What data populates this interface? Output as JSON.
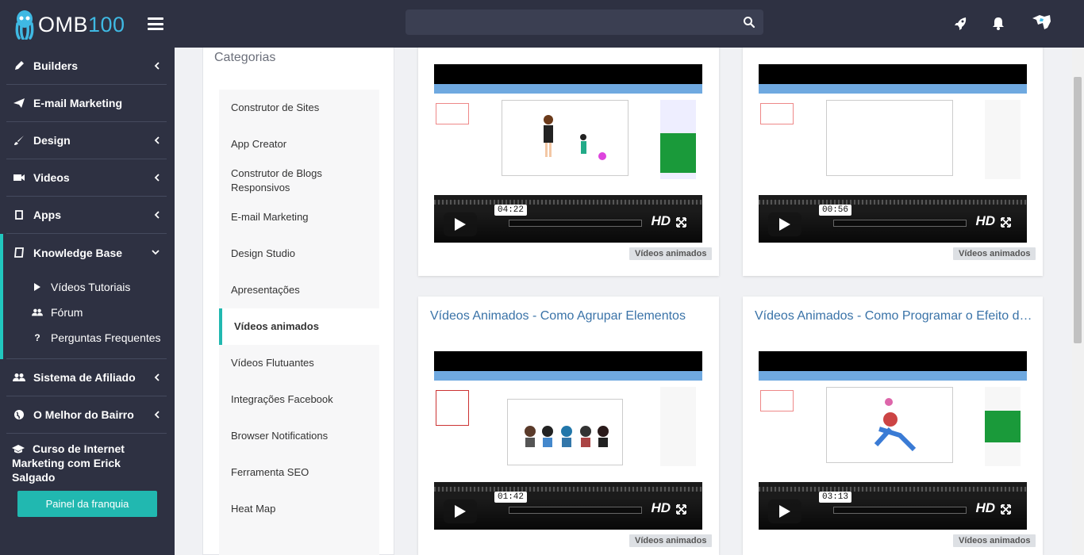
{
  "brand": {
    "logo_prefix": "OMB",
    "logo_suffix": "100",
    "accent": "#21b8b0",
    "link_color": "#3a73a8"
  },
  "topbar": {
    "search_placeholder": ""
  },
  "sidebar": {
    "items": [
      {
        "label": "Builders",
        "icon": "pencil-icon"
      },
      {
        "label": "E-mail Marketing",
        "icon": "paper-plane-icon"
      },
      {
        "label": "Design",
        "icon": "brush-icon"
      },
      {
        "label": "Videos",
        "icon": "video-camera-icon"
      },
      {
        "label": "Apps",
        "icon": "tablet-icon"
      }
    ],
    "knowledge_base": {
      "label": "Knowledge Base",
      "children": [
        {
          "label": "Vídeos Tutoriais",
          "icon": "play-icon"
        },
        {
          "label": "Fórum",
          "icon": "users-icon"
        },
        {
          "label": "Perguntas Frequentes",
          "icon": "question-icon"
        }
      ]
    },
    "items_after": [
      {
        "label": "Sistema de Afiliado",
        "icon": "users-icon"
      },
      {
        "label": "O Melhor do Bairro",
        "icon": "globe-icon"
      }
    ],
    "course": {
      "label": "Curso de Internet Marketing com Erick Salgado",
      "icon": "graduation-cap-icon"
    },
    "franchise_button": "Painel da franquia"
  },
  "categories": {
    "title": "Categorias",
    "items": [
      "Construtor de Sites",
      "App Creator",
      "Construtor de Blogs Responsivos",
      "E-mail Marketing",
      "Design Studio",
      "Apresentações",
      "Vídeos animados",
      "Vídeos Flutuantes",
      "Integrações Facebook",
      "Browser Notifications",
      "Ferramenta SEO",
      "Heat Map"
    ],
    "active": "Vídeos animados"
  },
  "videos": [
    {
      "title": "",
      "duration": "04:22",
      "tag": "Vídeos animados"
    },
    {
      "title": "",
      "duration": "00:56",
      "tag": "Vídeos animados"
    },
    {
      "title": "Vídeos Animados - Como Agrupar Elementos",
      "duration": "01:42",
      "tag": "Vídeos animados"
    },
    {
      "title": "Vídeos Animados - Como Programar o Efeito de…",
      "duration": "03:13",
      "tag": "Vídeos animados"
    }
  ],
  "player": {
    "hd_label": "HD"
  }
}
